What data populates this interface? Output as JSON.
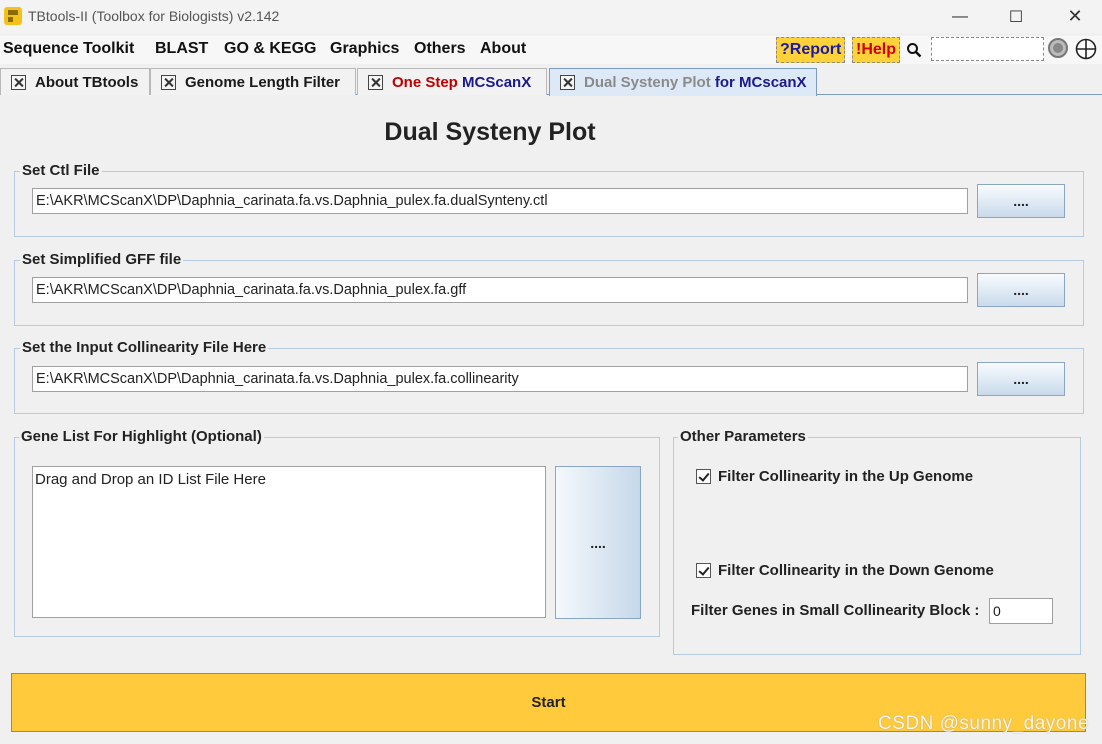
{
  "window": {
    "title": "TBtools-II (Toolbox for Biologists) v2.142",
    "minimize": "—",
    "maximize": "☐",
    "close": "✕"
  },
  "menu": {
    "items": [
      "Sequence Toolkit",
      "BLAST",
      "GO & KEGG",
      "Graphics",
      "Others",
      "About"
    ],
    "report": "?Report",
    "help": "!Help"
  },
  "tabs": [
    {
      "label": "About TBtools"
    },
    {
      "label": "Genome Length Filter"
    },
    {
      "label_red": "One Step ",
      "label_blue": "MCScanX"
    },
    {
      "label_gray": "Dual Systeny Plot ",
      "label_blue": "for MCscanX"
    }
  ],
  "main": {
    "title": "Dual Systeny Plot",
    "ctl": {
      "label": "Set Ctl File",
      "value": "E:\\AKR\\MCScanX\\DP\\Daphnia_carinata.fa.vs.Daphnia_pulex.fa.dualSynteny.ctl",
      "button": "...."
    },
    "gff": {
      "label": "Set Simplified GFF file",
      "value": "E:\\AKR\\MCScanX\\DP\\Daphnia_carinata.fa.vs.Daphnia_pulex.fa.gff",
      "button": "...."
    },
    "collinearity": {
      "label": "Set the Input Collinearity File Here",
      "value": "E:\\AKR\\MCScanX\\DP\\Daphnia_carinata.fa.vs.Daphnia_pulex.fa.collinearity",
      "button": "...."
    },
    "gene_list": {
      "label": "Gene List For Highlight (Optional)",
      "placeholder": "Drag and Drop an ID List File Here",
      "button": "...."
    },
    "params": {
      "label": "Other Parameters",
      "filter_up": "Filter Collinearity in the Up Genome",
      "filter_down": "Filter Collinearity in the Down Genome",
      "small_block_label": "Filter Genes in Small Collinearity Block :",
      "small_block_value": "0"
    },
    "start": "Start"
  },
  "watermark": "CSDN @sunny_dayone",
  "colors": {
    "accent_yellow": "#ffcb3d",
    "tab_red": "#c00000",
    "tab_blue": "#1a1a8c",
    "tab_gray": "#8a8a8a"
  }
}
